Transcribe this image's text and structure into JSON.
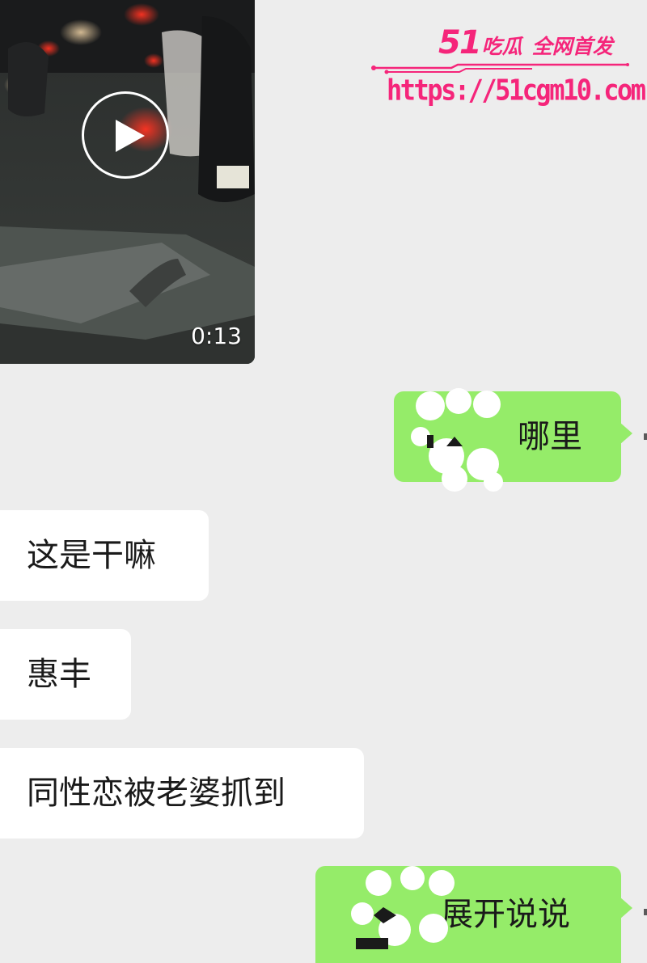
{
  "video": {
    "duration": "0:13",
    "icon": "play-icon"
  },
  "watermark": {
    "brand_number": "51",
    "brand_name": "吃瓜",
    "tagline": "全网首发",
    "url": "https://51cgm10.com",
    "color": "#f5257a"
  },
  "messages": [
    {
      "direction": "outgoing",
      "text": "哪里"
    },
    {
      "direction": "incoming",
      "text": "这是干嘛"
    },
    {
      "direction": "incoming",
      "text": "惠丰"
    },
    {
      "direction": "incoming",
      "text": "同性恋被老婆抓到"
    },
    {
      "direction": "outgoing",
      "text": "展开说说"
    }
  ],
  "colors": {
    "background": "#ededed",
    "incoming_bubble": "#ffffff",
    "outgoing_bubble": "#95ec69",
    "text": "#1a1a1a"
  }
}
